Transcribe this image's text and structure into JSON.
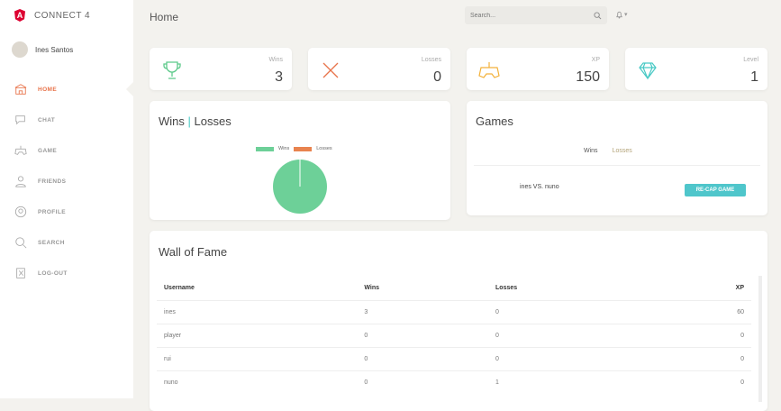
{
  "app": {
    "title": "CONNECT 4",
    "logo_letter": "A",
    "brand_color": "#dd0031"
  },
  "user": {
    "name": "Ines Santos"
  },
  "sidebar": {
    "items": [
      {
        "label": "HOME",
        "icon": "home-icon",
        "active": true
      },
      {
        "label": "CHAT",
        "icon": "chat-icon"
      },
      {
        "label": "GAME",
        "icon": "gamepad-icon"
      },
      {
        "label": "FRIENDS",
        "icon": "user-icon"
      },
      {
        "label": "PROFILE",
        "icon": "profile-icon"
      },
      {
        "label": "SEARCH",
        "icon": "search-icon"
      },
      {
        "label": "LOG-OUT",
        "icon": "logout-icon"
      }
    ]
  },
  "header": {
    "title": "Home",
    "search_placeholder": "Search..."
  },
  "stats": [
    {
      "label": "Wins",
      "value": "3",
      "icon": "trophy-icon",
      "color": "#5cc98a"
    },
    {
      "label": "Losses",
      "value": "0",
      "icon": "x-icon",
      "color": "#e8734a"
    },
    {
      "label": "XP",
      "value": "150",
      "icon": "gamepad-icon",
      "color": "#f3b13a"
    },
    {
      "label": "Level",
      "value": "1",
      "icon": "diamond-icon",
      "color": "#48c9c5"
    }
  ],
  "winsLosses": {
    "title_a": "Wins",
    "title_sep": "|",
    "title_b": "Losses"
  },
  "chart_data": {
    "type": "pie",
    "series": [
      {
        "name": "Wins",
        "value": 3,
        "color": "#6dd098"
      },
      {
        "name": "Losses",
        "value": 0,
        "color": "#e8834f"
      }
    ],
    "legend": "top"
  },
  "games": {
    "title": "Games",
    "tabs": [
      "Wins",
      "Losses"
    ],
    "matches": [
      {
        "label": "ines VS. nuno",
        "button": "RE-CAP GAME"
      }
    ]
  },
  "wall": {
    "title": "Wall of Fame",
    "columns": [
      "Username",
      "Wins",
      "Losses",
      "XP"
    ],
    "rows": [
      [
        "ines",
        "3",
        "0",
        "60"
      ],
      [
        "player",
        "0",
        "0",
        "0"
      ],
      [
        "rui",
        "0",
        "0",
        "0"
      ],
      [
        "nuno",
        "0",
        "1",
        "0"
      ]
    ]
  }
}
